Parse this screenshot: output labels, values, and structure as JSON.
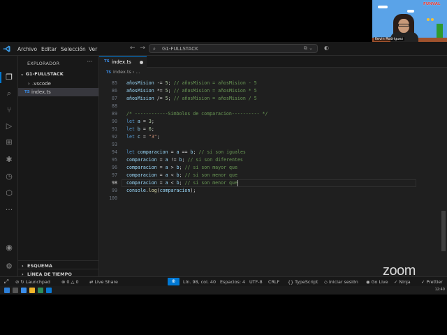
{
  "titlebar": {
    "menus": [
      "Archivo",
      "Editar",
      "Selección",
      "Ver"
    ],
    "command_center": "G1-FULLSTACK"
  },
  "sidebar": {
    "title": "EXPLORADOR",
    "folder": "G1-FULLSTACK",
    "items": [
      {
        "label": ".vscode",
        "type": "folder"
      },
      {
        "label": "index.ts",
        "type": "ts",
        "selected": true
      }
    ],
    "sections": [
      "ESQUEMA",
      "LÍNEA DE TIEMPO"
    ]
  },
  "editor": {
    "tab": {
      "label": "index.ts",
      "badge": "TS",
      "dirty": true
    },
    "breadcrumb": {
      "file": "index.ts",
      "rest": "..."
    },
    "lines": [
      {
        "n": "85",
        "text": "añosMision -= 5; // añosMision = añosMision - 5"
      },
      {
        "n": "86",
        "text": "añosMision *= 5; // añosMision = añosMision * 5"
      },
      {
        "n": "87",
        "text": "añosMision /= 5; // añosMision = añosMision / 5"
      },
      {
        "n": "88",
        "text": ""
      },
      {
        "n": "89",
        "text": "/* ------------Simbolos de comparacion---------- */"
      },
      {
        "n": "90",
        "text": "let a = 3;"
      },
      {
        "n": "91",
        "text": "let b = 6;"
      },
      {
        "n": "92",
        "text": "let c = \"3\";"
      },
      {
        "n": "93",
        "text": ""
      },
      {
        "n": "94",
        "text": "let comparacion = a == b; // si son iguales"
      },
      {
        "n": "95",
        "text": "comparacion = a != b; // si son diferentes"
      },
      {
        "n": "96",
        "text": "comparacion = a > b; // si son mayor que"
      },
      {
        "n": "97",
        "text": "comparacion = a < b; // si son menor que"
      },
      {
        "n": "98",
        "text": "comparacion = a < b; // si son menor que"
      },
      {
        "n": "99",
        "text": "console.log(comparacion);"
      },
      {
        "n": "100",
        "text": ""
      }
    ],
    "current_line": "98"
  },
  "statusbar": {
    "errors": "0",
    "warnings": "0",
    "launchpad": "Launchpad",
    "live_share": "Live Share",
    "position": "Lín. 98, col. 40",
    "spaces": "Espacios: 4",
    "encoding": "UTF-8",
    "eol": "CRLF",
    "language": "TypeScript",
    "signin": "Iniciar sesión",
    "go_live": "Go Live",
    "ninja": "Ninja",
    "prettier": "Prettier"
  },
  "overlay": {
    "zoom_logo": "zoom",
    "webcam_name": "Kevin Rodriguez",
    "webcam_logo": "FUNVAL"
  },
  "taskbar": {
    "clock": "12:40"
  }
}
